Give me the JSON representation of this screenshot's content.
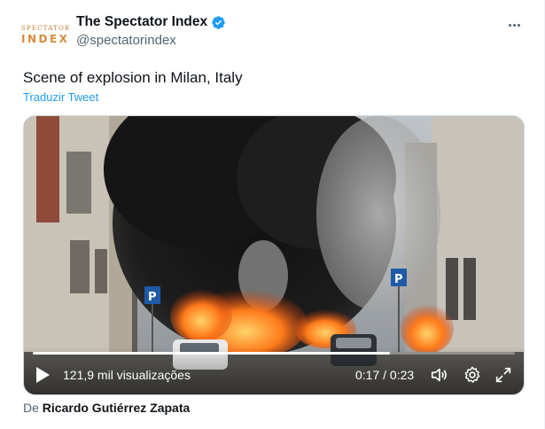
{
  "author": {
    "avatar_line1": "SPECTATOR",
    "avatar_line2": "INDEX",
    "display_name": "The Spectator Index",
    "handle": "@spectatorindex",
    "verified_color": "#1d9bf0"
  },
  "tweet": {
    "text": "Scene of explosion in Milan, Italy",
    "translate_label": "Traduzir Tweet"
  },
  "video": {
    "views": "121,9 mil visualizações",
    "time": "0:17 / 0:23",
    "progress": 0.74,
    "icons": [
      "play-icon",
      "volume-icon",
      "settings-icon",
      "fullscreen-icon"
    ]
  },
  "credit": {
    "prefix": "De",
    "name": "Ricardo Gutiérrez Zapata"
  },
  "colors": {
    "link": "#1d9bf0",
    "secondary_text": "#536471",
    "brand_orange": "#d88a3c"
  }
}
